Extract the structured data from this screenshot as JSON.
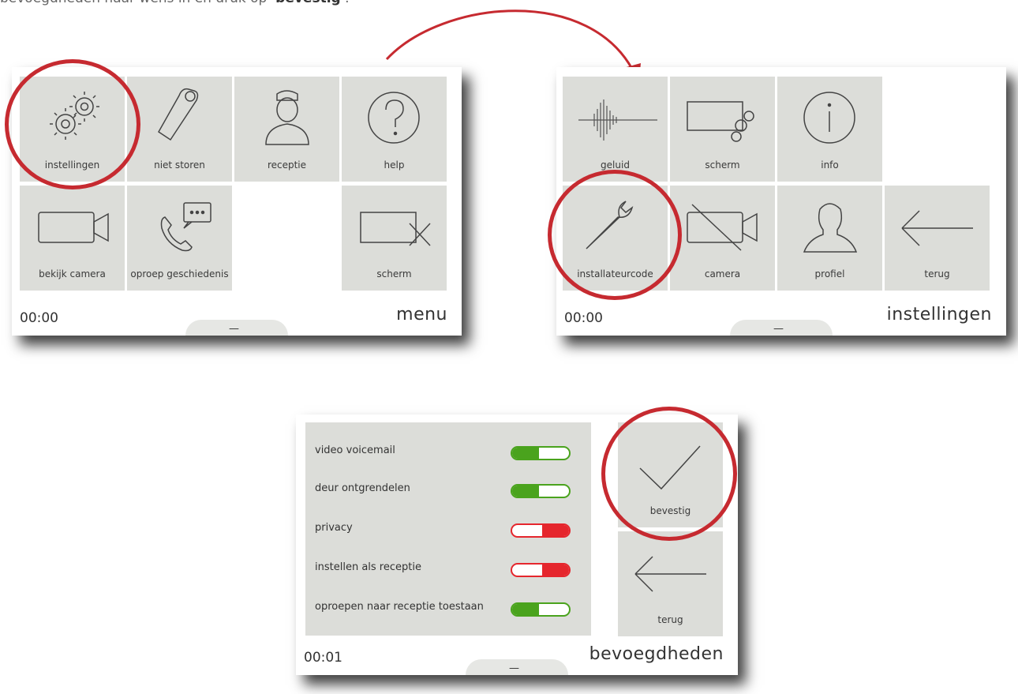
{
  "intro": {
    "text_before": "bevoegdheden naar wens in en druk op ‘",
    "bold": "bevestig",
    "text_after": "’."
  },
  "colors": {
    "tile": "#dcddd9",
    "highlight": "#c62a30",
    "on": "#4aa31d",
    "off": "#e5262d"
  },
  "menu_screen": {
    "title": "menu",
    "clock": "00:00",
    "tiles": [
      {
        "label": "instellingen",
        "icon": "gears-icon"
      },
      {
        "label": "niet storen",
        "icon": "door-hanger-icon"
      },
      {
        "label": "receptie",
        "icon": "receptionist-icon"
      },
      {
        "label": "help",
        "icon": "question-icon"
      },
      {
        "label": "bekijk camera",
        "icon": "camera-icon"
      },
      {
        "label": "oproep geschiedenis",
        "icon": "phone-message-icon"
      },
      {
        "label": "scherm",
        "icon": "screen-off-icon"
      }
    ]
  },
  "settings_screen": {
    "title": "instellingen",
    "clock": "00:00",
    "tiles": [
      {
        "label": "geluid",
        "icon": "sound-wave-icon"
      },
      {
        "label": "scherm",
        "icon": "screen-settings-icon"
      },
      {
        "label": "info",
        "icon": "info-icon"
      },
      {
        "label": "installateurcode",
        "icon": "wrench-icon"
      },
      {
        "label": "camera",
        "icon": "camera-off-icon"
      },
      {
        "label": "profiel",
        "icon": "profile-icon"
      },
      {
        "label": "terug",
        "icon": "back-arrow-icon"
      }
    ]
  },
  "permissions_screen": {
    "title": "bevoegdheden",
    "clock": "00:01",
    "permissions": [
      {
        "label": "video voicemail",
        "state": "on"
      },
      {
        "label": "deur ontgrendelen",
        "state": "on"
      },
      {
        "label": "privacy",
        "state": "off"
      },
      {
        "label": "instellen als receptie",
        "state": "off"
      },
      {
        "label": "oproepen naar receptie toestaan",
        "state": "on"
      }
    ],
    "confirm_label": "bevestig",
    "back_label": "terug"
  }
}
